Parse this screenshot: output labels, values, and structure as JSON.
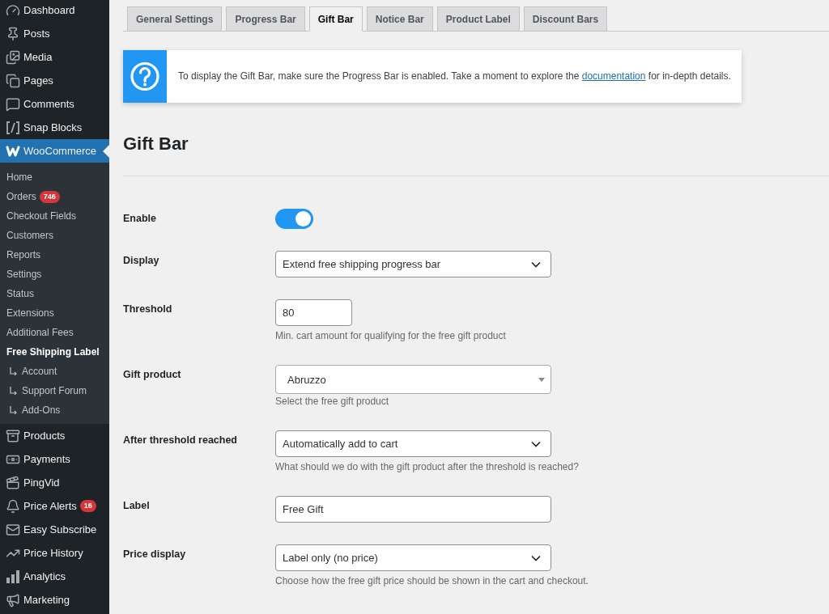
{
  "sidebar": {
    "items": [
      {
        "label": "Dashboard",
        "selected": false
      },
      {
        "label": "Posts",
        "selected": false
      },
      {
        "label": "Media",
        "selected": false
      },
      {
        "label": "Pages",
        "selected": false
      },
      {
        "label": "Comments",
        "selected": false
      },
      {
        "label": "Snap Blocks",
        "selected": false
      },
      {
        "label": "WooCommerce",
        "selected": true,
        "children": [
          {
            "label": "Home",
            "selected": false
          },
          {
            "label": "Orders",
            "selected": false,
            "badge": "746"
          },
          {
            "label": "Checkout Fields",
            "selected": false
          },
          {
            "label": "Customers",
            "selected": false
          },
          {
            "label": "Reports",
            "selected": false
          },
          {
            "label": "Settings",
            "selected": false
          },
          {
            "label": "Status",
            "selected": false
          },
          {
            "label": "Extensions",
            "selected": false
          },
          {
            "label": "Additional Fees",
            "selected": false
          },
          {
            "label": "Free Shipping Label",
            "selected": true,
            "children": [
              {
                "label": "Account",
                "selected": false
              },
              {
                "label": "Support Forum",
                "selected": false
              },
              {
                "label": "Add-Ons",
                "selected": false
              }
            ]
          }
        ]
      },
      {
        "label": "Products",
        "selected": false
      },
      {
        "label": "Payments",
        "selected": false
      },
      {
        "label": "PingVid",
        "selected": false
      },
      {
        "label": "Price Alerts",
        "selected": false,
        "badge": "16"
      },
      {
        "label": "Easy Subscribe",
        "selected": false
      },
      {
        "label": "Price History",
        "selected": false
      },
      {
        "label": "Analytics",
        "selected": false
      },
      {
        "label": "Marketing",
        "selected": false
      }
    ]
  },
  "tabs": [
    {
      "label": "General Settings",
      "selected": false
    },
    {
      "label": "Progress Bar",
      "selected": false
    },
    {
      "label": "Gift Bar",
      "selected": true
    },
    {
      "label": "Notice Bar",
      "selected": false
    },
    {
      "label": "Product Label",
      "selected": false
    },
    {
      "label": "Discount Bars",
      "selected": false
    }
  ],
  "notice": {
    "text_before": "To display the Gift Bar, make sure the Progress Bar is enabled. Take a moment to explore the",
    "link": "documentation",
    "text_after": "for in-depth details."
  },
  "page_title": "Gift Bar",
  "settings": [
    {
      "kind": "toggle",
      "label": "Enable",
      "on": true
    },
    {
      "kind": "select",
      "label": "Display",
      "value": "Extend free shipping progress bar"
    },
    {
      "kind": "number",
      "label": "Threshold",
      "value": "80",
      "description": "Min. cart amount for qualifying for the free gift product"
    },
    {
      "kind": "combobox",
      "label": "Gift product",
      "value": "Abruzzo",
      "description": "Select the free gift product"
    },
    {
      "kind": "select",
      "label": "After threshold reached",
      "value": "Automatically add to cart",
      "description": "What should we do with the gift product after the threshold is reached?"
    },
    {
      "kind": "text",
      "label": "Label",
      "value": "Free Gift"
    },
    {
      "kind": "select",
      "label": "Price display",
      "value": "Label only (no price)",
      "description": "Choose how the free gift price should be shown in the cart and checkout."
    }
  ]
}
